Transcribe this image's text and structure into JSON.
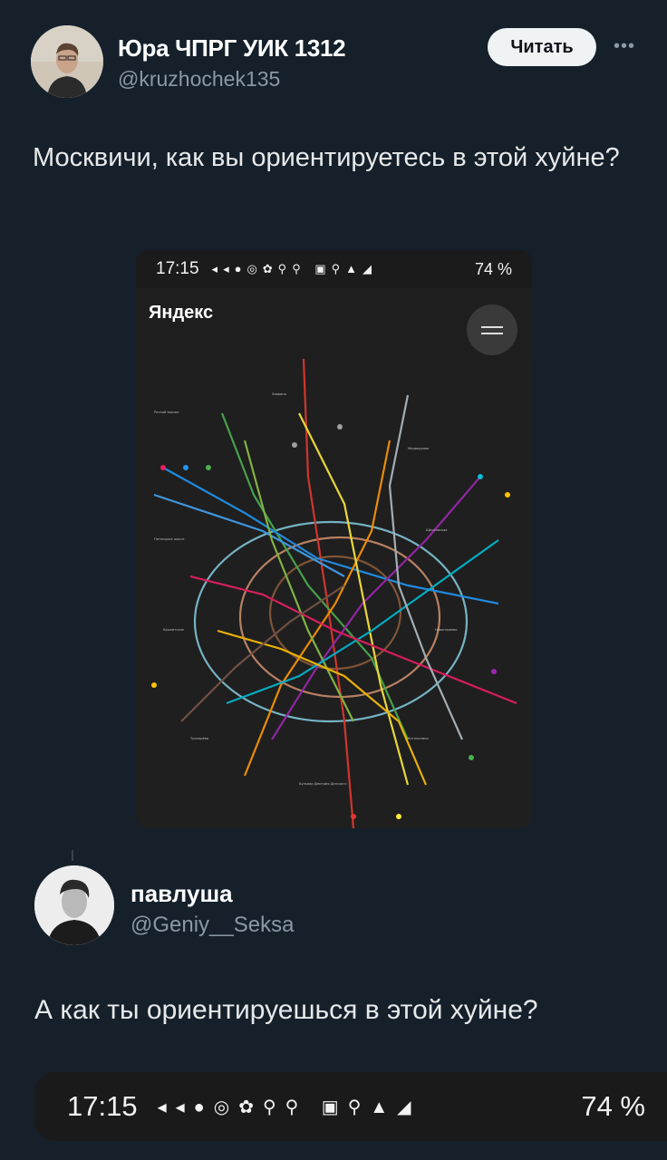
{
  "tweet": {
    "author_name": "Юра ЧПРГ УИК 1312",
    "author_handle": "@kruzhochek135",
    "read_label": "Читать",
    "more_icon": "more-horizontal-icon",
    "text": "Москвичи, как вы ориентируетесь в этой хуйне?"
  },
  "media": {
    "status_time": "17:15",
    "status_battery": "74 %",
    "app_logo": "Яндекс",
    "menu_icon": "menu-icon"
  },
  "reply": {
    "author_name": "павлуша",
    "author_handle": "@Geniy__Seksa",
    "text": "А как ты ориентируешься в этой хуйне?"
  },
  "status_bar": {
    "time": "17:15",
    "battery": "74 %"
  },
  "colors": {
    "background": "#15202b",
    "handle": "#8b98a5",
    "button_bg": "#eff3f4"
  }
}
